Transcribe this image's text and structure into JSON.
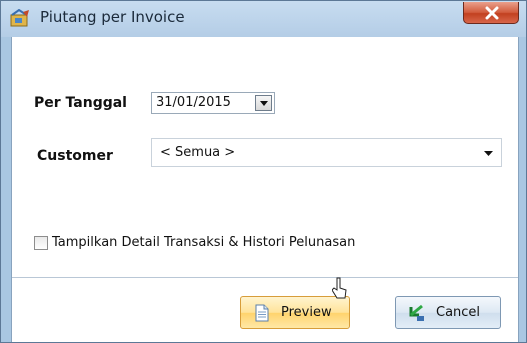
{
  "window": {
    "title": "Piutang per Invoice",
    "close_icon": "close-icon"
  },
  "form": {
    "per_tanggal_label": "Per Tanggal",
    "per_tanggal_value": "31/01/2015",
    "customer_label": "Customer",
    "customer_value": "< Semua >",
    "detail_checkbox_label": "Tampilkan Detail Transaksi & Histori Pelunasan",
    "detail_checkbox_checked": false
  },
  "buttons": {
    "preview_label": "Preview",
    "cancel_label": "Cancel"
  }
}
